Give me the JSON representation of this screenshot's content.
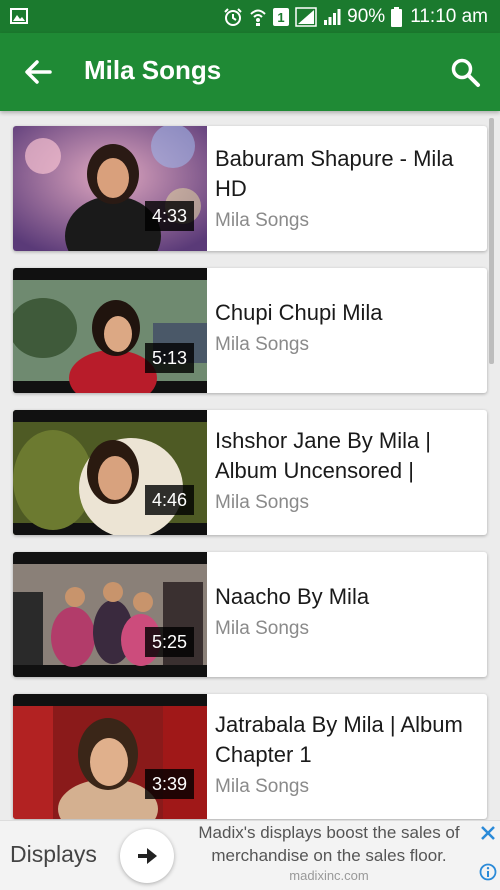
{
  "status_bar": {
    "battery_percent": "90%",
    "time": "11:10 am",
    "sim_slot": "1",
    "icons": [
      "image-icon",
      "alarm-icon",
      "wifi-calling-icon",
      "sim-icon",
      "signal-icon",
      "signal-icon",
      "battery-icon"
    ]
  },
  "app_bar": {
    "title": "Mila Songs",
    "back_icon": "arrow-back-icon",
    "search_icon": "search-icon",
    "color": "#1f8a35"
  },
  "videos": [
    {
      "title": "Baburam Shapure - Mila HD",
      "channel": "Mila Songs",
      "duration": "4:33"
    },
    {
      "title": "Chupi Chupi Mila",
      "channel": "Mila Songs",
      "duration": "5:13"
    },
    {
      "title": "Ishshor Jane By Mila | Album Uncensored |",
      "channel": "Mila Songs",
      "duration": "4:46"
    },
    {
      "title": "Naacho By Mila",
      "channel": "Mila Songs",
      "duration": "5:25"
    },
    {
      "title": "Jatrabala By Mila | Album Chapter 1",
      "channel": "Mila Songs",
      "duration": "3:39"
    }
  ],
  "ad": {
    "brand": "Displays",
    "line1": "Madix's displays boost the sales of",
    "line2": "merchandise on the sales floor.",
    "url": "madixinc.com",
    "close_icon": "close-icon",
    "info_icon": "info-icon",
    "go_icon": "arrow-right-icon"
  }
}
